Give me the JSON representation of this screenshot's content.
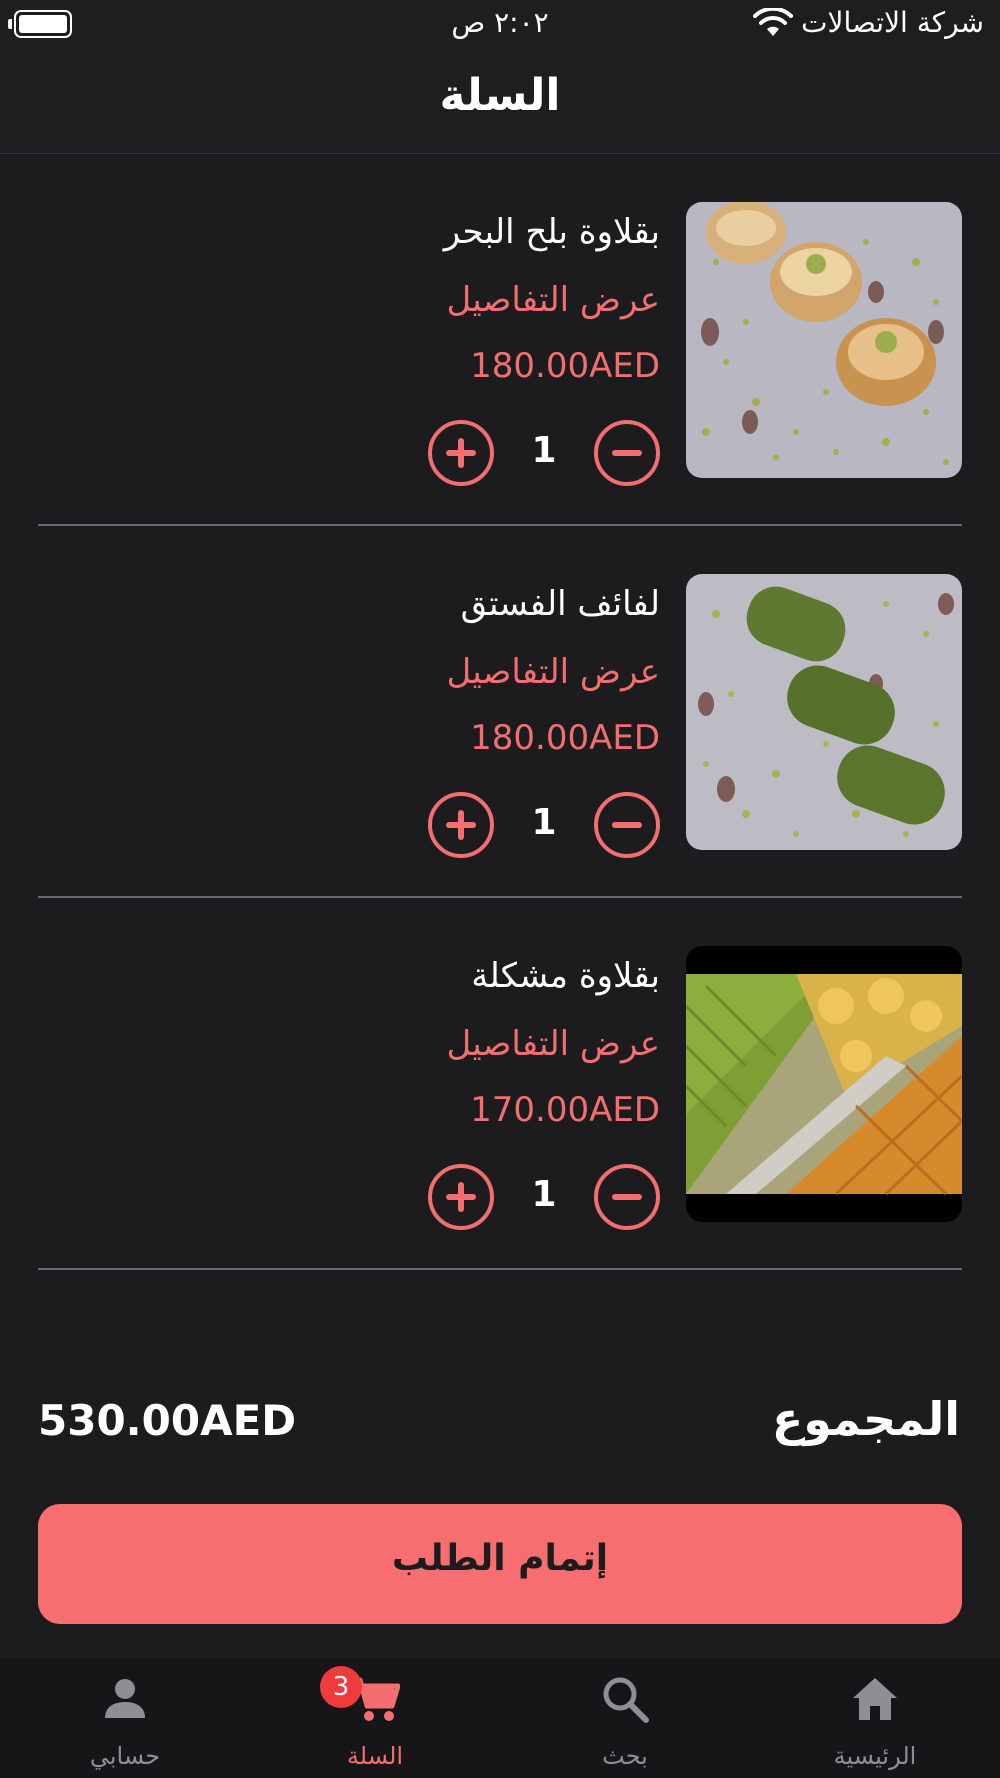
{
  "status_bar": {
    "time": "٢:٠٢ ص",
    "carrier": "شركة الاتصالات",
    "icons": [
      "battery-icon",
      "wifi-icon"
    ]
  },
  "header": {
    "title": "السلة"
  },
  "cart": {
    "details_label": "عرض التفاصيل",
    "items": [
      {
        "name": "بقلاوة بلح البحر",
        "price": "180.00AED",
        "quantity": "1",
        "image": "baklava-photo"
      },
      {
        "name": "لفائف الفستق",
        "price": "180.00AED",
        "quantity": "1",
        "image": "pistachio-rolls-photo"
      },
      {
        "name": "بقلاوة مشكلة",
        "price": "170.00AED",
        "quantity": "1",
        "image": "mixed-baklava-photo"
      }
    ]
  },
  "summary": {
    "total_label": "المجموع",
    "total_value": "530.00AED",
    "checkout_label": "إتمام الطلب"
  },
  "tabs": [
    {
      "label": "حسابي",
      "icon": "person-icon"
    },
    {
      "label": "السلة",
      "icon": "cart-icon",
      "active": true,
      "badge": "3"
    },
    {
      "label": "بحث",
      "icon": "search-icon"
    },
    {
      "label": "الرئيسية",
      "icon": "home-icon"
    }
  ],
  "colors": {
    "accent": "#f26e6f",
    "button": "#f76e70",
    "background": "#1c1c1e",
    "badge": "#ef3b3b"
  }
}
